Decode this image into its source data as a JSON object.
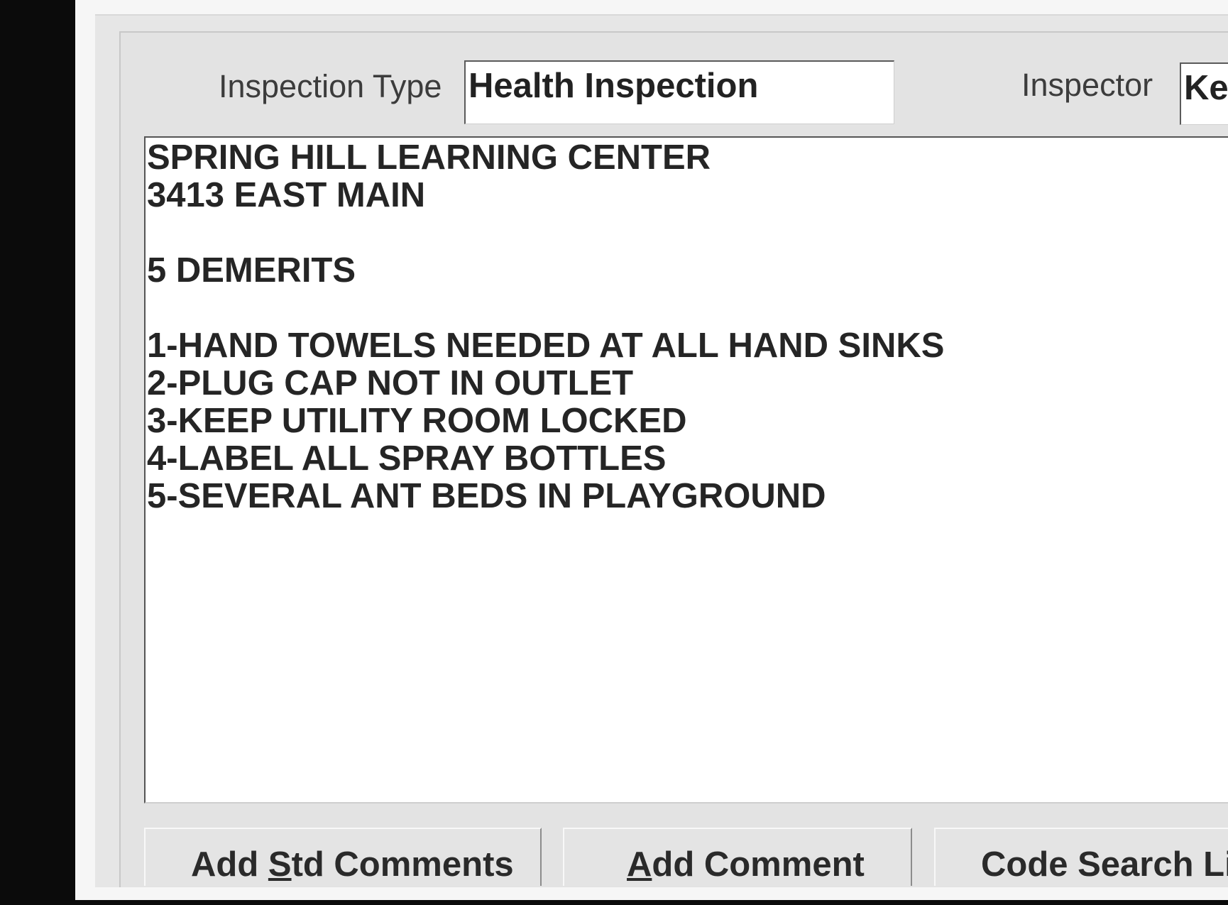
{
  "form": {
    "inspection_type_label": "Inspection Type",
    "inspection_type_value": "Health Inspection",
    "inspector_label": "Inspector",
    "inspector_value": "Ke"
  },
  "comments": {
    "lines": [
      "SPRING HILL LEARNING CENTER",
      "3413 EAST MAIN",
      "",
      "5 DEMERITS",
      "",
      "1-HAND TOWELS NEEDED AT ALL HAND SINKS",
      "2-PLUG CAP NOT IN OUTLET",
      "3-KEEP UTILITY ROOM LOCKED",
      "4-LABEL ALL SPRAY BOTTLES",
      "5-SEVERAL ANT BEDS IN PLAYGROUND"
    ]
  },
  "buttons": {
    "add_std_comments": {
      "before": "Add ",
      "key": "S",
      "after": "td Comments"
    },
    "add_comment": {
      "before": "",
      "key": "A",
      "after": "dd Comment"
    },
    "code_search": "Code Search Li"
  }
}
